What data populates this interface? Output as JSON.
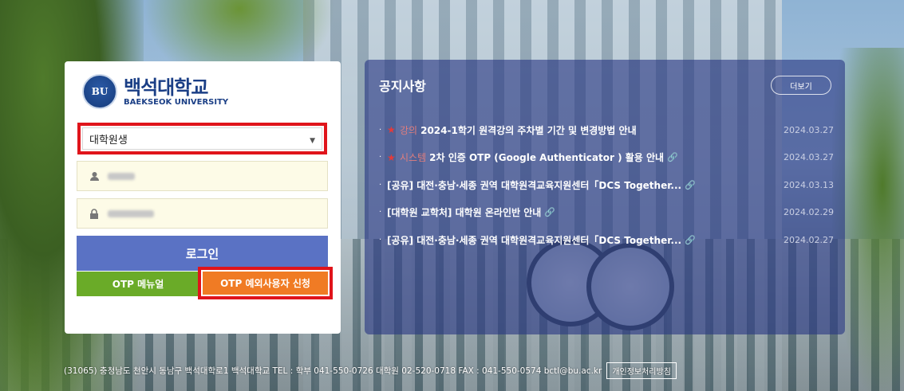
{
  "login": {
    "logo_emblem": "BU",
    "logo_ko": "백석대학교",
    "logo_en": "BAEKSEOK UNIVERSITY",
    "user_type_selected": "대학원생",
    "login_button": "로그인",
    "otp_manual_button": "OTP 메뉴얼",
    "otp_exception_button": "OTP 예외사용자 신청"
  },
  "notice": {
    "title": "공지사항",
    "more_button": "더보기",
    "items": [
      {
        "star": "★",
        "category": "강의",
        "title": "2024-1학기 원격강의 주차별 기간 및 변경방법 안내",
        "date": "2024.03.27"
      },
      {
        "star": "★",
        "category": "시스템",
        "title": "2차 인증 OTP (Google Authenticator ) 활용 안내",
        "date": "2024.03.27"
      },
      {
        "star": "",
        "category": "",
        "title": "[공유] 대전·충남·세종 권역 대학원격교육지원센터「DCS Together...",
        "date": "2024.03.13"
      },
      {
        "star": "",
        "category": "",
        "title": "[대학원 교학처] 대학원 온라인반 안내",
        "date": "2024.02.29"
      },
      {
        "star": "",
        "category": "",
        "title": "[공유] 대전·충남·세종 권역 대학원격교육지원센터「DCS Together...",
        "date": "2024.02.27"
      }
    ]
  },
  "footer": {
    "address": "(31065) 충청남도 천안시 동남구 백석대학로1 백석대학교 TEL : 학부 041-550-0726 대학원 02-520-0718 FAX : 041-550-0574 bctl@bu.ac.kr",
    "privacy_link": "개인정보처리방침"
  }
}
